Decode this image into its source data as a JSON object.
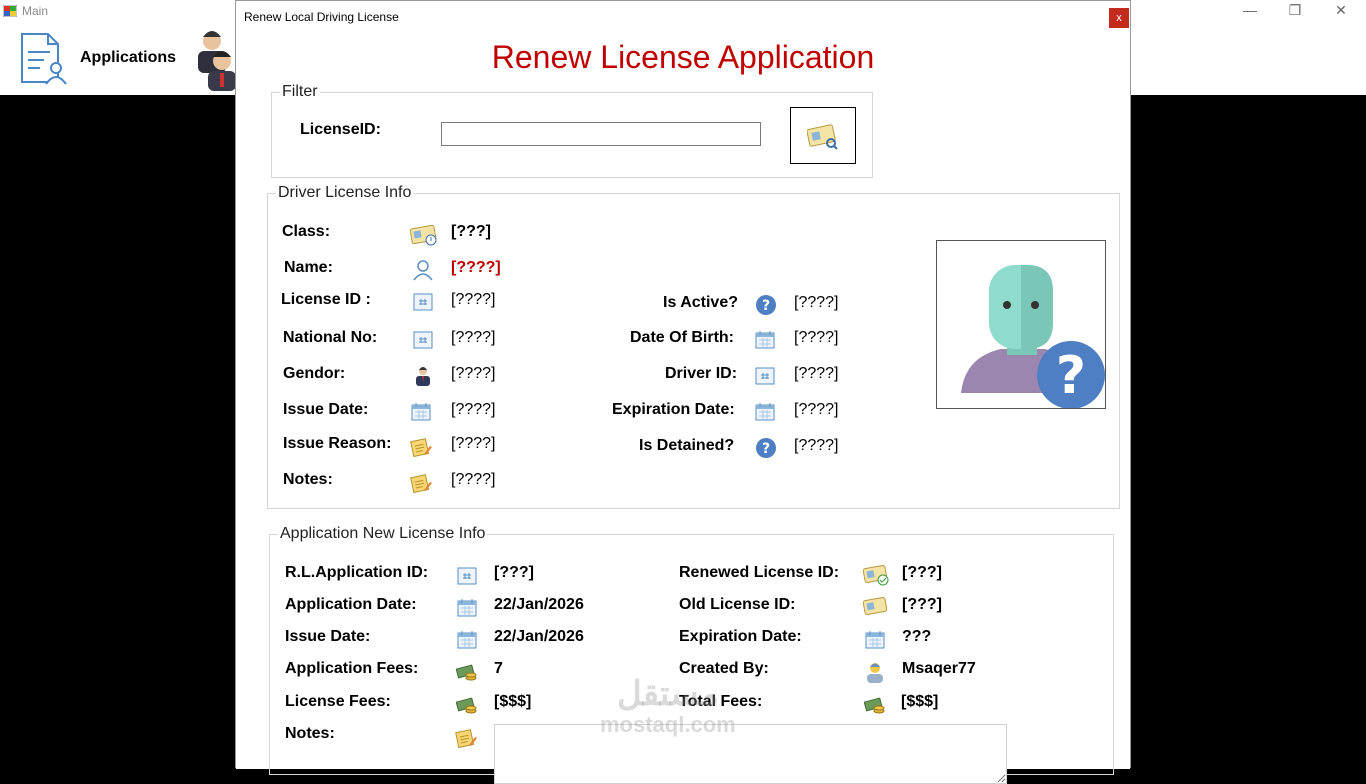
{
  "main": {
    "title": "Main",
    "applications_label": "Applications"
  },
  "dialog": {
    "title": "Renew Local Driving License",
    "close": "x",
    "heading": "Renew License Application"
  },
  "filter": {
    "legend": "Filter",
    "license_id_label": "LicenseID:",
    "license_id_value": ""
  },
  "driver_info": {
    "legend": "Driver License Info",
    "class_label": "Class:",
    "class_value": "[???]",
    "name_label": "Name:",
    "name_value": "[????]",
    "license_id_label": "License ID :",
    "license_id_value": "[????]",
    "national_no_label": "National No:",
    "national_no_value": "[????]",
    "gender_label": "Gendor:",
    "gender_value": "[????]",
    "issue_date_label": "Issue Date:",
    "issue_date_value": "[????]",
    "issue_reason_label": "Issue Reason:",
    "issue_reason_value": "[????]",
    "notes_label": "Notes:",
    "notes_value": "[????]",
    "is_active_label": "Is Active?",
    "is_active_value": "[????]",
    "dob_label": "Date Of Birth:",
    "dob_value": "[????]",
    "driver_id_label": "Driver ID:",
    "driver_id_value": "[????]",
    "expiration_label": "Expiration Date:",
    "expiration_value": "[????]",
    "is_detained_label": "Is Detained?",
    "is_detained_value": "[????]"
  },
  "app_info": {
    "legend": "Application New License Info",
    "rl_app_id_label": "R.L.Application ID:",
    "rl_app_id_value": "[???]",
    "app_date_label": "Application Date:",
    "app_date_value": "22/Jan/2026",
    "issue_date_label": "Issue Date:",
    "issue_date_value": "22/Jan/2026",
    "app_fees_label": "Application Fees:",
    "app_fees_value": "7",
    "license_fees_label": "License  Fees:",
    "license_fees_value": "[$$$]",
    "notes_label": "Notes:",
    "renewed_license_id_label": "Renewed License ID:",
    "renewed_license_id_value": "[???]",
    "old_license_id_label": "Old License ID:",
    "old_license_id_value": "[???]",
    "expiration_label": "Expiration Date:",
    "expiration_value": "???",
    "created_by_label": "Created By:",
    "created_by_value": "Msaqer77",
    "total_fees_label": "Total  Fees:",
    "total_fees_value": "[$$$]"
  },
  "watermark": {
    "arabic": "مستقل",
    "latin": "mostaql.com"
  },
  "colors": {
    "heading": "#c00000",
    "close_button": "#c42b1c"
  }
}
